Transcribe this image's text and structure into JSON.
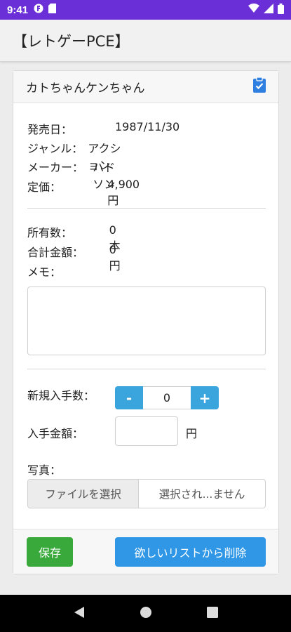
{
  "status_bar": {
    "time": "9:41"
  },
  "app": {
    "title": "【レトゲーPCE】"
  },
  "game": {
    "title": "カトちゃんケンちゃん",
    "details": [
      {
        "label": "発売日：",
        "value": "1987/11/30"
      },
      {
        "label": "ジャンル：",
        "value": "アクション"
      },
      {
        "label": "メーカー：",
        "value": "ハドソン"
      },
      {
        "label": "定価：",
        "value": "4,900円"
      }
    ]
  },
  "owned": {
    "count_label": "所有数：",
    "count_value": "0本",
    "total_label": "合計金額：",
    "total_value": "0円",
    "memo_label": "メモ："
  },
  "acquire": {
    "quantity_label": "新規入手数：",
    "minus_label": "-",
    "plus_label": "+",
    "quantity_value": "0",
    "amount_label": "入手金額：",
    "amount_unit": "円",
    "photo_label": "写真：",
    "file_button": "ファイルを選択",
    "file_status": "選択され...ません"
  },
  "actions": {
    "save": "保存",
    "remove_from_wishlist": "欲しいリストから削除"
  },
  "colors": {
    "status_bar": "#6a2fd6",
    "stepper": "#3aa4dd",
    "save": "#39a93b",
    "delete": "#2f97e6"
  }
}
